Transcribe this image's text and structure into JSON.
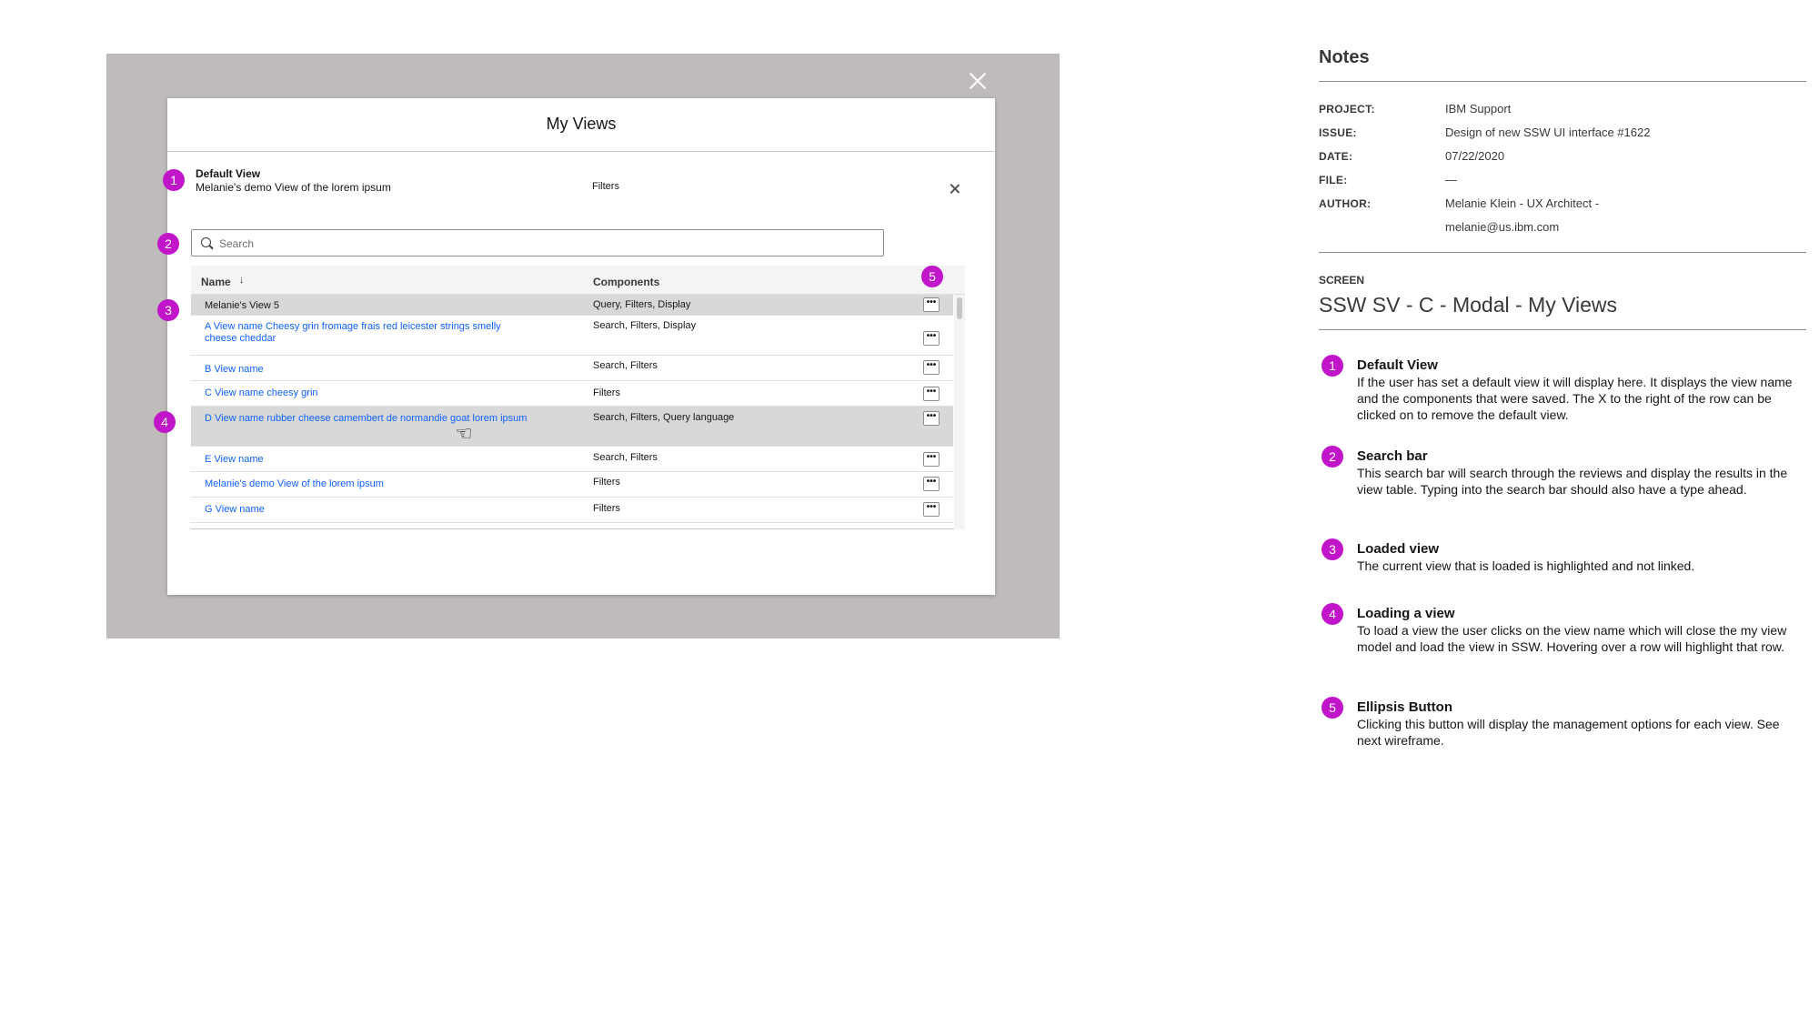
{
  "modal": {
    "title": "My Views",
    "default_view": {
      "heading": "Default View",
      "name": "Melanie's demo View of the lorem ipsum",
      "components": "Filters"
    },
    "search": {
      "placeholder": "Search",
      "value": ""
    },
    "table": {
      "columns": {
        "name": "Name",
        "components": "Components"
      },
      "sort_icon": "arrow-down-icon",
      "ellipsis_label": "•••",
      "rows": [
        {
          "name": "Melanie's View 5",
          "components": "Query, Filters, Display",
          "state": "loaded"
        },
        {
          "name": "A View name Cheesy grin fromage frais red leicester strings smelly cheese cheddar",
          "components": "Search, Filters, Display",
          "state": "link"
        },
        {
          "name": "B View name",
          "components": "Search, Filters",
          "state": "link"
        },
        {
          "name": "C View name cheesy grin",
          "components": "Filters",
          "state": "link"
        },
        {
          "name": "D View name rubber cheese camembert de normandie goat lorem ipsum",
          "components": "Search, Filters, Query language",
          "state": "hover"
        },
        {
          "name": "E View name",
          "components": "Search, Filters",
          "state": "link"
        },
        {
          "name": "Melanie's demo View of the lorem ipsum",
          "components": "Filters",
          "state": "link"
        },
        {
          "name": "G View name",
          "components": "Filters",
          "state": "link"
        }
      ]
    }
  },
  "badges": [
    "1",
    "2",
    "3",
    "4",
    "5"
  ],
  "notes": {
    "heading": "Notes",
    "meta": [
      {
        "label": "PROJECT:",
        "value": "IBM Support"
      },
      {
        "label": "ISSUE:",
        "value": "Design of new SSW UI interface #1622"
      },
      {
        "label": "DATE:",
        "value": "07/22/2020"
      },
      {
        "label": "FILE:",
        "value": "—"
      },
      {
        "label": "AUTHOR:",
        "value": "Melanie Klein - UX Architect - melanie@us.ibm.com"
      }
    ],
    "screen_label": "SCREEN",
    "screen_title": "SSW SV - C - Modal - My Views",
    "items": [
      {
        "num": "1",
        "title": "Default View",
        "text": "If the user has set a default view it will display here. It displays the view name and the components that were saved. The X to the right of the row can be clicked on to remove the default view."
      },
      {
        "num": "2",
        "title": "Search bar",
        "text": "This search bar will search through the reviews and display the results in the view table. Typing into the search bar should also have a type ahead."
      },
      {
        "num": "3",
        "title": "Loaded view",
        "text": "The current view that is loaded is highlighted and not linked."
      },
      {
        "num": "4",
        "title": "Loading a view",
        "text": "To load a view the user clicks on the view name which will close the my view model and load the view in SSW. Hovering over a row will highlight that row."
      },
      {
        "num": "5",
        "title": "Ellipsis Button",
        "text": "Clicking this button will display the management options for each view. See next wireframe."
      }
    ]
  },
  "colors": {
    "overlay": "#bfbbbb",
    "badge": "#c015c9",
    "link": "#0f62fe",
    "row_highlight": "#d8d8d8"
  }
}
